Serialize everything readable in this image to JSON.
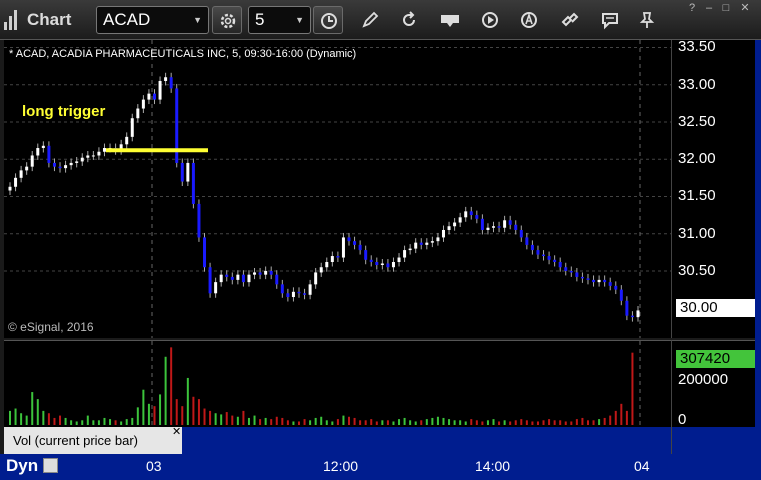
{
  "toolbar": {
    "title": "Chart",
    "symbol": "ACAD",
    "interval": "5"
  },
  "chart": {
    "title": "* ACAD, ACADIA PHARMACEUTICALS INC, 5, 09:30-16:00 (Dynamic)",
    "copyright": "© eSignal, 2016",
    "annotation": "long trigger",
    "annotation_color": "#ffff33",
    "up_color": "#ffffff",
    "down_color": "#1a1aff",
    "price_ticks": [
      "33.50",
      "33.00",
      "32.50",
      "32.00",
      "31.50",
      "31.00",
      "30.50"
    ],
    "last_price": "30.00",
    "volume_ticks": [
      "200000",
      "0"
    ],
    "last_volume": "307420",
    "vol_study_label": "Vol (current price bar)",
    "time_labels": [
      "03",
      "12:00",
      "14:00",
      "04"
    ],
    "time_pane_label": "Dyn"
  },
  "chart_data": {
    "type": "candlestick",
    "title": "* ACAD, ACADIA PHARMACEUTICALS INC, 5, 09:30-16:00 (Dynamic)",
    "y_range": [
      29.6,
      33.6
    ],
    "long_trigger_level": 32.12,
    "close_sequence": [
      31.63,
      31.75,
      31.85,
      31.9,
      32.05,
      32.15,
      32.18,
      31.95,
      31.9,
      31.88,
      31.92,
      31.95,
      31.97,
      32.02,
      32.05,
      32.05,
      32.1,
      32.15,
      32.15,
      32.12,
      32.2,
      32.3,
      32.55,
      32.68,
      32.8,
      32.88,
      32.8,
      33.05,
      33.1,
      32.95,
      31.95,
      31.7,
      31.95,
      31.4,
      30.95,
      30.55,
      30.2,
      30.35,
      30.45,
      30.42,
      30.38,
      30.45,
      30.35,
      30.45,
      30.48,
      30.45,
      30.5,
      30.45,
      30.32,
      30.2,
      30.15,
      30.22,
      30.2,
      30.18,
      30.32,
      30.48,
      30.55,
      30.62,
      30.7,
      30.68,
      30.95,
      30.9,
      30.85,
      30.78,
      30.65,
      30.62,
      30.58,
      30.6,
      30.55,
      30.62,
      30.68,
      30.78,
      30.8,
      30.88,
      30.85,
      30.88,
      30.9,
      30.95,
      31.05,
      31.1,
      31.15,
      31.22,
      31.3,
      31.25,
      31.2,
      31.05,
      31.08,
      31.1,
      31.08,
      31.18,
      31.12,
      31.05,
      30.95,
      30.85,
      30.78,
      30.72,
      30.7,
      30.65,
      30.62,
      30.55,
      30.5,
      30.48,
      30.42,
      30.4,
      30.38,
      30.35,
      30.38,
      30.35,
      30.3,
      30.25,
      30.1,
      29.9,
      29.88,
      29.97
    ],
    "volume_sequence": [
      60000,
      70000,
      50000,
      40000,
      140000,
      110000,
      60000,
      50000,
      30000,
      40000,
      30000,
      20000,
      15000,
      20000,
      40000,
      20000,
      20000,
      30000,
      25000,
      20000,
      15000,
      25000,
      30000,
      75000,
      150000,
      90000,
      80000,
      130000,
      290000,
      330000,
      110000,
      80000,
      200000,
      120000,
      110000,
      70000,
      60000,
      50000,
      45000,
      55000,
      40000,
      35000,
      60000,
      30000,
      40000,
      25000,
      30000,
      25000,
      35000,
      30000,
      20000,
      15000,
      15000,
      25000,
      20000,
      30000,
      35000,
      20000,
      15000,
      25000,
      40000,
      35000,
      30000,
      20000,
      20000,
      25000,
      15000,
      20000,
      20000,
      15000,
      25000,
      30000,
      20000,
      15000,
      20000,
      25000,
      30000,
      35000,
      30000,
      25000,
      20000,
      20000,
      15000,
      25000,
      20000,
      15000,
      20000,
      25000,
      15000,
      20000,
      15000,
      20000,
      25000,
      20000,
      15000,
      15000,
      20000,
      25000,
      20000,
      20000,
      15000,
      15000,
      25000,
      30000,
      20000,
      20000,
      25000,
      30000,
      40000,
      60000,
      90000,
      60000,
      307420
    ]
  }
}
